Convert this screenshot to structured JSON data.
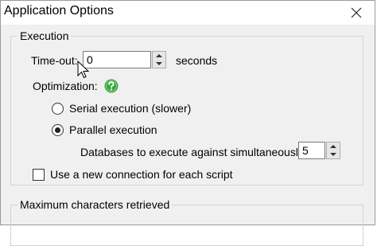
{
  "window": {
    "title": "Application Options"
  },
  "execution": {
    "legend": "Execution",
    "timeout_label": "Time-out:",
    "timeout_value": "0",
    "timeout_unit": "seconds",
    "optimization_label": "Optimization:",
    "serial_label": "Serial execution (slower)",
    "parallel_label": "Parallel execution",
    "selected_mode": "parallel",
    "databases_label": "Databases to execute against simultaneously:",
    "databases_value": "5",
    "new_connection_label": "Use a new connection for each script",
    "new_connection_checked": false
  },
  "max_chars": {
    "legend": "Maximum characters retrieved"
  },
  "icons": {
    "help": "help-question-icon",
    "close": "close-icon"
  },
  "colors": {
    "help_green": "#3aa63a"
  }
}
